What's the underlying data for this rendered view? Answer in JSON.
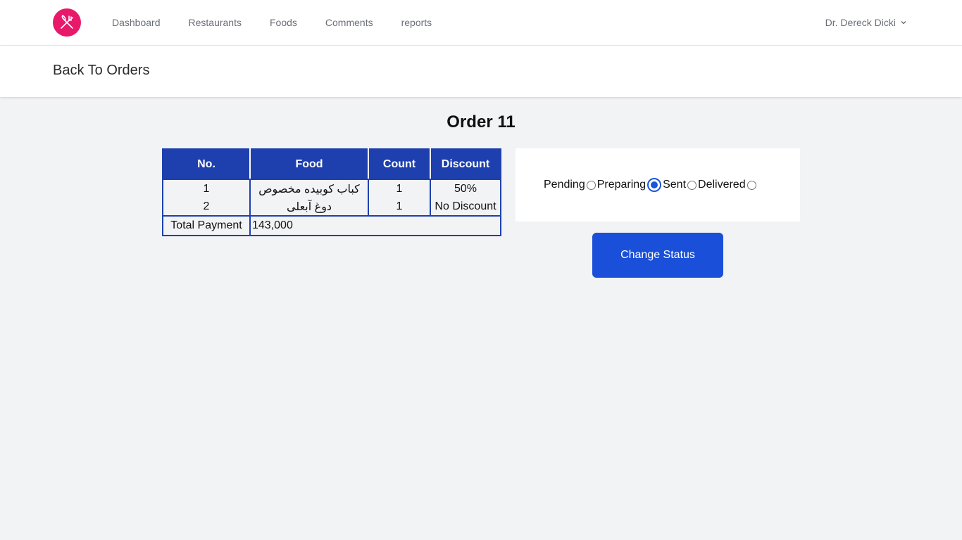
{
  "nav": {
    "links": [
      "Dashboard",
      "Restaurants",
      "Foods",
      "Comments",
      "reports"
    ],
    "user_name": "Dr. Dereck Dicki",
    "logo_icon": "fork-knife-icon",
    "logo_color": "#e8196b"
  },
  "subheader": {
    "back_label": "Back To Orders"
  },
  "order": {
    "title": "Order 11",
    "columns": [
      "No.",
      "Food",
      "Count",
      "Discount"
    ],
    "rows": [
      {
        "no": "1",
        "food": "کباب کوبیده مخصوص",
        "count": "1",
        "discount": "50%"
      },
      {
        "no": "2",
        "food": "دوغ آبعلی",
        "count": "1",
        "discount": "No Discount"
      }
    ],
    "total_label": "Total Payment",
    "total_value": "143,000"
  },
  "status": {
    "options": [
      "Pending",
      "Preparing",
      "Sent",
      "Delivered"
    ],
    "selected": "Preparing"
  },
  "change_button_label": "Change Status",
  "colors": {
    "table_header": "#1e40af",
    "button": "#1a4fd9",
    "accent": "#1a56db"
  }
}
